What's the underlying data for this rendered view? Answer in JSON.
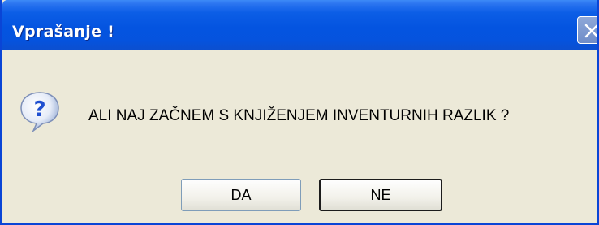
{
  "dialog": {
    "title": "Vprašanje !",
    "message": "ALI NAJ ZAČNEM S KNJIŽENJEM INVENTURNIH RAZLIK ?",
    "icon": "question-icon",
    "close_icon": "close-icon"
  },
  "buttons": {
    "yes_label": "DA",
    "no_label": "NE"
  },
  "colors": {
    "titlebar": "#0454e0",
    "window_bg": "#ece9d8",
    "title_text": "#ffffff",
    "icon_blue": "#1f4fd0"
  }
}
